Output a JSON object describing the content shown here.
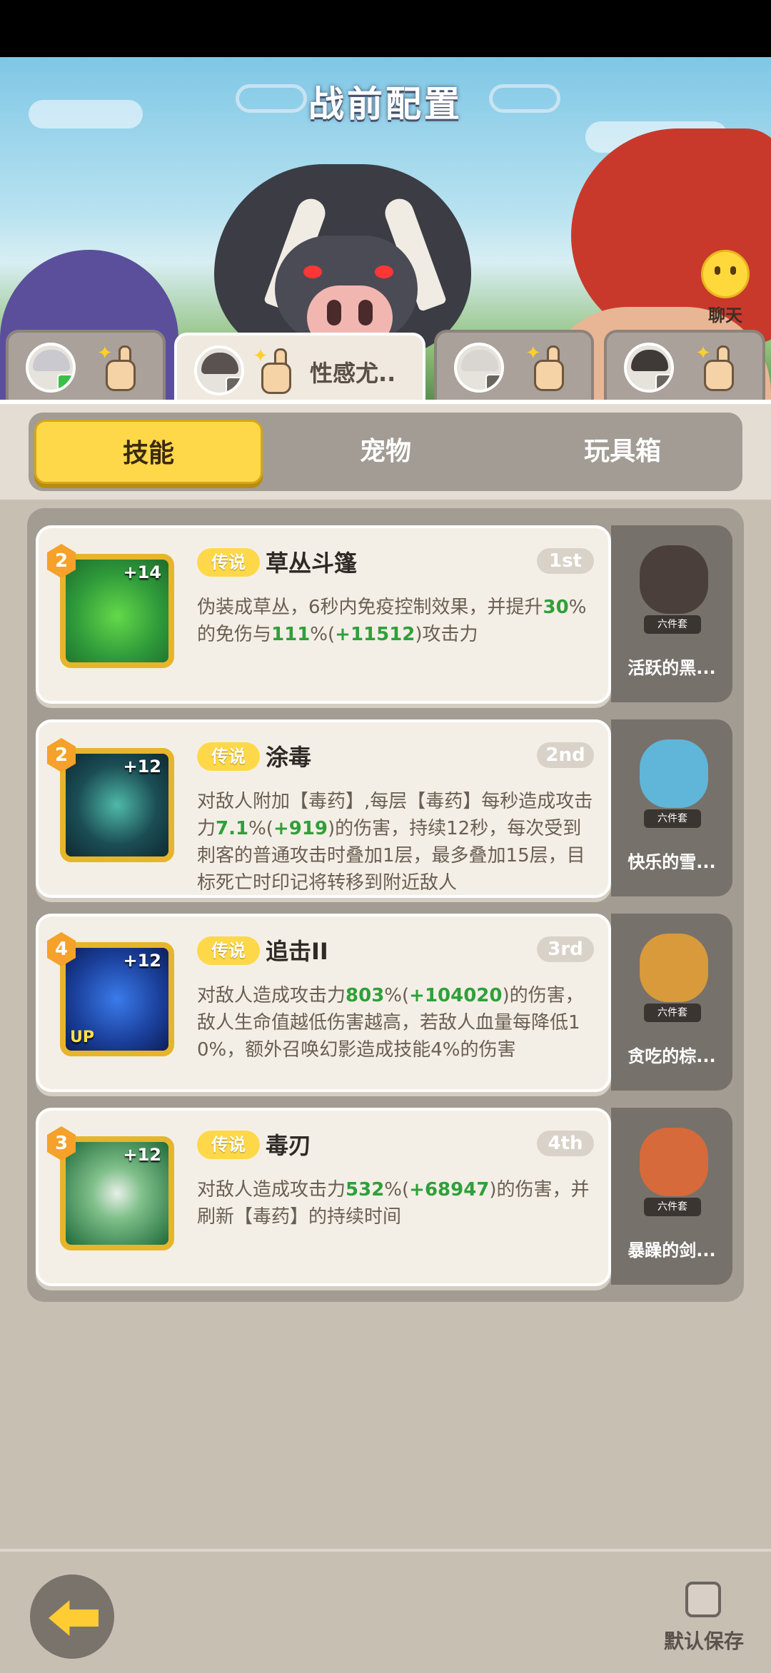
{
  "header": {
    "title": "战前配置",
    "chat_label": "聊天"
  },
  "hero_tabs": [
    {
      "name": "",
      "active": false
    },
    {
      "name": "性感尤..",
      "active": true
    },
    {
      "name": "",
      "active": false
    },
    {
      "name": "",
      "active": false
    }
  ],
  "tabs": [
    {
      "label": "技能",
      "active": true
    },
    {
      "label": "宠物",
      "active": false
    },
    {
      "label": "玩具箱",
      "active": false
    }
  ],
  "skills": [
    {
      "level": "2",
      "bonus": "+14",
      "rarity": "传说",
      "name": "草丛斗篷",
      "order": "1st",
      "desc": [
        "伪装成草丛，6秒内免疫控制效果，并提升",
        "30",
        "%的免伤与",
        "111",
        "%(",
        "+11512",
        ")攻击力"
      ],
      "set_tag": "六件套",
      "set_name": "活跃的黑..."
    },
    {
      "level": "2",
      "bonus": "+12",
      "rarity": "传说",
      "name": "涂毒",
      "order": "2nd",
      "desc": [
        "对敌人附加【毒药】,每层【毒药】每秒造成攻击力",
        "7.1",
        "%(",
        "+919",
        ")的伤害，持续12秒，每次受到刺客的普通攻击时叠加1层，最多叠加15层，目标死亡时印记将转移到附近敌人"
      ],
      "set_tag": "六件套",
      "set_name": "快乐的雪..."
    },
    {
      "level": "4",
      "bonus": "+12",
      "up": "UP",
      "rarity": "传说",
      "name": "追击II",
      "order": "3rd",
      "desc": [
        "对敌人造成攻击力",
        "803",
        "%(",
        "+104020",
        ")的伤害，敌人生命值越低伤害越高，若敌人血量每降低10%，额外召唤幻影造成技能4%的伤害"
      ],
      "set_tag": "六件套",
      "set_name": "贪吃的棕..."
    },
    {
      "level": "3",
      "bonus": "+12",
      "rarity": "传说",
      "name": "毒刃",
      "order": "4th",
      "desc": [
        "对敌人造成攻击力",
        "532",
        "%(",
        "+68947",
        ")的伤害，并刷新【毒药】的持续时间"
      ],
      "set_tag": "六件套",
      "set_name": "暴躁的剑..."
    }
  ],
  "footer": {
    "save_label": "默认保存"
  },
  "colors": {
    "accent": "#ffd84a",
    "green": "#2fa03a",
    "panel": "#c8bfb3"
  }
}
